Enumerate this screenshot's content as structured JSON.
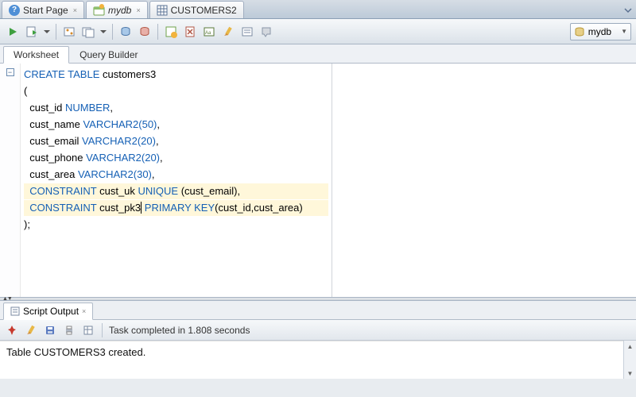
{
  "tabs": {
    "start": "Start Page",
    "mydb": "mydb",
    "customers2": "CUSTOMERS2"
  },
  "connection": {
    "label": "mydb"
  },
  "subtabs": {
    "worksheet": "Worksheet",
    "querybuilder": "Query Builder"
  },
  "code": {
    "l1a": "CREATE TABLE ",
    "l1b": "customers3",
    "l2": "(",
    "l3a": "  cust_id ",
    "l3b": "NUMBER",
    "l3c": ",",
    "l4a": "  cust_name ",
    "l4b": "VARCHAR2(50)",
    "l4c": ",",
    "l5a": "  cust_email ",
    "l5b": "VARCHAR2(20)",
    "l5c": ",",
    "l6a": "  cust_phone ",
    "l6b": "VARCHAR2(20)",
    "l6c": ",",
    "l7a": "  cust_area ",
    "l7b": "VARCHAR2(30)",
    "l7c": ",",
    "l8a": "  CONSTRAINT ",
    "l8b": "cust_uk ",
    "l8c": "UNIQUE ",
    "l8d": "(cust_email),",
    "l9a": "  CONSTRAINT ",
    "l9b": "cust_pk3",
    "l9c": " PRIMARY KEY",
    "l9d": "(cust_id,cust_area)",
    "l10": ");"
  },
  "output": {
    "tab": "Script Output",
    "status": "Task completed in 1.808 seconds",
    "body": "Table CUSTOMERS3 created."
  },
  "icons": {
    "help": "?",
    "sql": "SQL",
    "table": "▦"
  }
}
